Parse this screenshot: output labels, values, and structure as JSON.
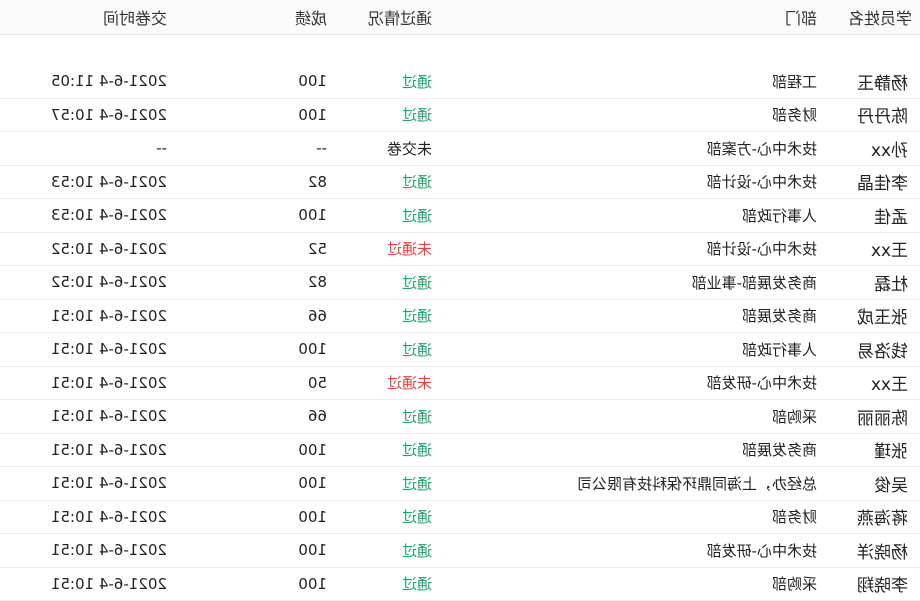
{
  "table": {
    "headers": [
      "学员姓名",
      "部门",
      "通过情况",
      "成绩",
      "交卷时间"
    ],
    "rows": [
      {
        "name": "杨静玉",
        "dept": "工程部",
        "status": "通过",
        "status_type": "pass",
        "score": "100",
        "time": "2021-6-4 11:05"
      },
      {
        "name": "陈丹丹",
        "dept": "财务部",
        "status": "通过",
        "status_type": "pass",
        "score": "100",
        "time": "2021-6-4 10:57"
      },
      {
        "name": "孙xx",
        "dept": "技术中心-方案部",
        "status": "未交卷",
        "status_type": "none",
        "score": "--",
        "time": "--"
      },
      {
        "name": "李佳晶",
        "dept": "技术中心-设计部",
        "status": "通过",
        "status_type": "pass",
        "score": "82",
        "time": "2021-6-4 10:53"
      },
      {
        "name": "孟佳",
        "dept": "人事行政部",
        "status": "通过",
        "status_type": "pass",
        "score": "100",
        "time": "2021-6-4 10:53"
      },
      {
        "name": "王xx",
        "dept": "技术中心-设计部",
        "status": "未通过",
        "status_type": "fail",
        "score": "52",
        "time": "2021-6-4 10:52"
      },
      {
        "name": "杜磊",
        "dept": "商务发展部-事业部",
        "status": "通过",
        "status_type": "pass",
        "score": "82",
        "time": "2021-6-4 10:52"
      },
      {
        "name": "张玉成",
        "dept": "商务发展部",
        "status": "通过",
        "status_type": "pass",
        "score": "66",
        "time": "2021-6-4 10:51"
      },
      {
        "name": "钱洛易",
        "dept": "人事行政部",
        "status": "通过",
        "status_type": "pass",
        "score": "100",
        "time": "2021-6-4 10:51"
      },
      {
        "name": "王xx",
        "dept": "技术中心-研发部",
        "status": "未通过",
        "status_type": "fail",
        "score": "50",
        "time": "2021-6-4 10:51"
      },
      {
        "name": "陈丽丽",
        "dept": "采购部",
        "status": "通过",
        "status_type": "pass",
        "score": "66",
        "time": "2021-6-4 10:51"
      },
      {
        "name": "张瑾",
        "dept": "商务发展部",
        "status": "通过",
        "status_type": "pass",
        "score": "100",
        "time": "2021-6-4 10:51"
      },
      {
        "name": "吴俊",
        "dept": "总经办，上海同鼎环保科技有限公司",
        "status": "通过",
        "status_type": "pass",
        "score": "100",
        "time": "2021-6-4 10:51"
      },
      {
        "name": "蒋海燕",
        "dept": "财务部",
        "status": "通过",
        "status_type": "pass",
        "score": "100",
        "time": "2021-6-4 10:51"
      },
      {
        "name": "杨晓洋",
        "dept": "技术中心-研发部",
        "status": "通过",
        "status_type": "pass",
        "score": "100",
        "time": "2021-6-4 10:51"
      },
      {
        "name": "李晓翔",
        "dept": "采购部",
        "status": "通过",
        "status_type": "pass",
        "score": "100",
        "time": "2021-6-4 10:51"
      }
    ]
  }
}
